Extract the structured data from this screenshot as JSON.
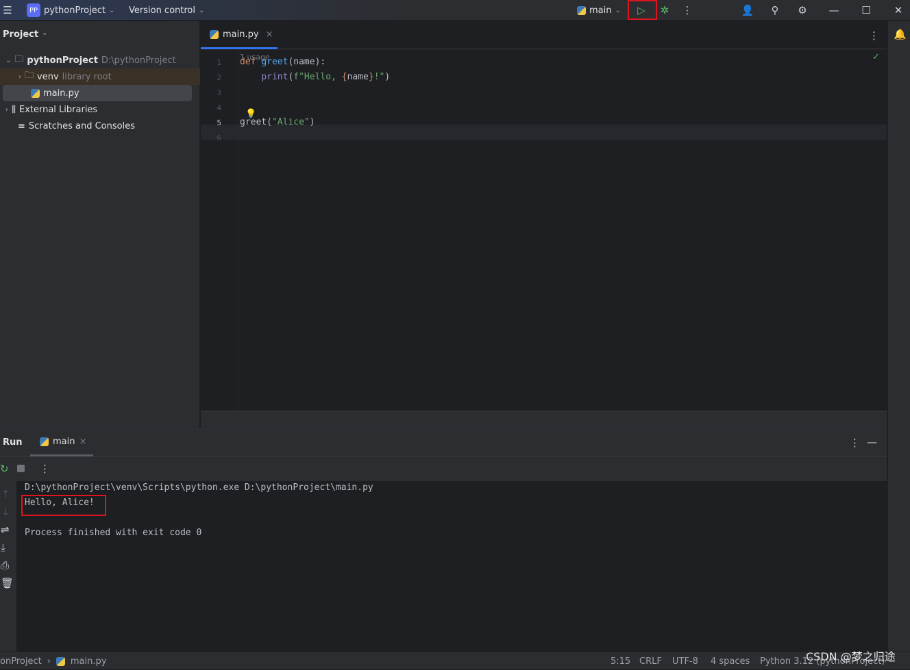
{
  "titlebar": {
    "project": "pythonProject",
    "project_badge": "PP",
    "vcs": "Version control",
    "run_config": "main"
  },
  "project_panel": {
    "title": "Project",
    "items": [
      {
        "label": "pythonProject",
        "hint": "D:\\pythonProject"
      },
      {
        "label": "venv",
        "hint": "library root"
      },
      {
        "label": "main.py"
      },
      {
        "label": "External Libraries"
      },
      {
        "label": "Scratches and Consoles"
      }
    ]
  },
  "editor": {
    "tab": "main.py",
    "usage_hint": "1 usage",
    "line_numbers": [
      "1",
      "2",
      "3",
      "4",
      "5",
      "6"
    ],
    "lines": [
      [
        {
          "t": "def ",
          "c": "kw"
        },
        {
          "t": "greet",
          "c": "fn"
        },
        {
          "t": "(name):",
          "c": ""
        }
      ],
      [
        {
          "t": "    ",
          "c": ""
        },
        {
          "t": "print",
          "c": "bi"
        },
        {
          "t": "(",
          "c": ""
        },
        {
          "t": "f\"Hello, ",
          "c": "st"
        },
        {
          "t": "{",
          "c": "kw"
        },
        {
          "t": "name",
          "c": ""
        },
        {
          "t": "}",
          "c": "kw"
        },
        {
          "t": "!\"",
          "c": "st"
        },
        {
          "t": ")",
          "c": ""
        }
      ],
      [],
      [],
      [
        {
          "t": "greet(",
          "c": ""
        },
        {
          "t": "\"Alice\"",
          "c": "st"
        },
        {
          "t": ")",
          "c": ""
        }
      ],
      []
    ]
  },
  "run": {
    "title": "Run",
    "tab": "main",
    "output": [
      "D:\\pythonProject\\venv\\Scripts\\python.exe D:\\pythonProject\\main.py",
      "Hello, Alice!",
      "",
      "Process finished with exit code 0"
    ]
  },
  "statusbar": {
    "breadcrumb_project": "onProject",
    "breadcrumb_file": "main.py",
    "position": "5:15",
    "line_sep": "CRLF",
    "encoding": "UTF-8",
    "indent": "4 spaces",
    "interpreter": "Python 3.12 (pythonProject)",
    "watermark": "CSDN @梦之归途"
  },
  "colors": {
    "accent": "#3574f0",
    "run_green": "#5fb865",
    "highlight_red": "#e0141c"
  }
}
